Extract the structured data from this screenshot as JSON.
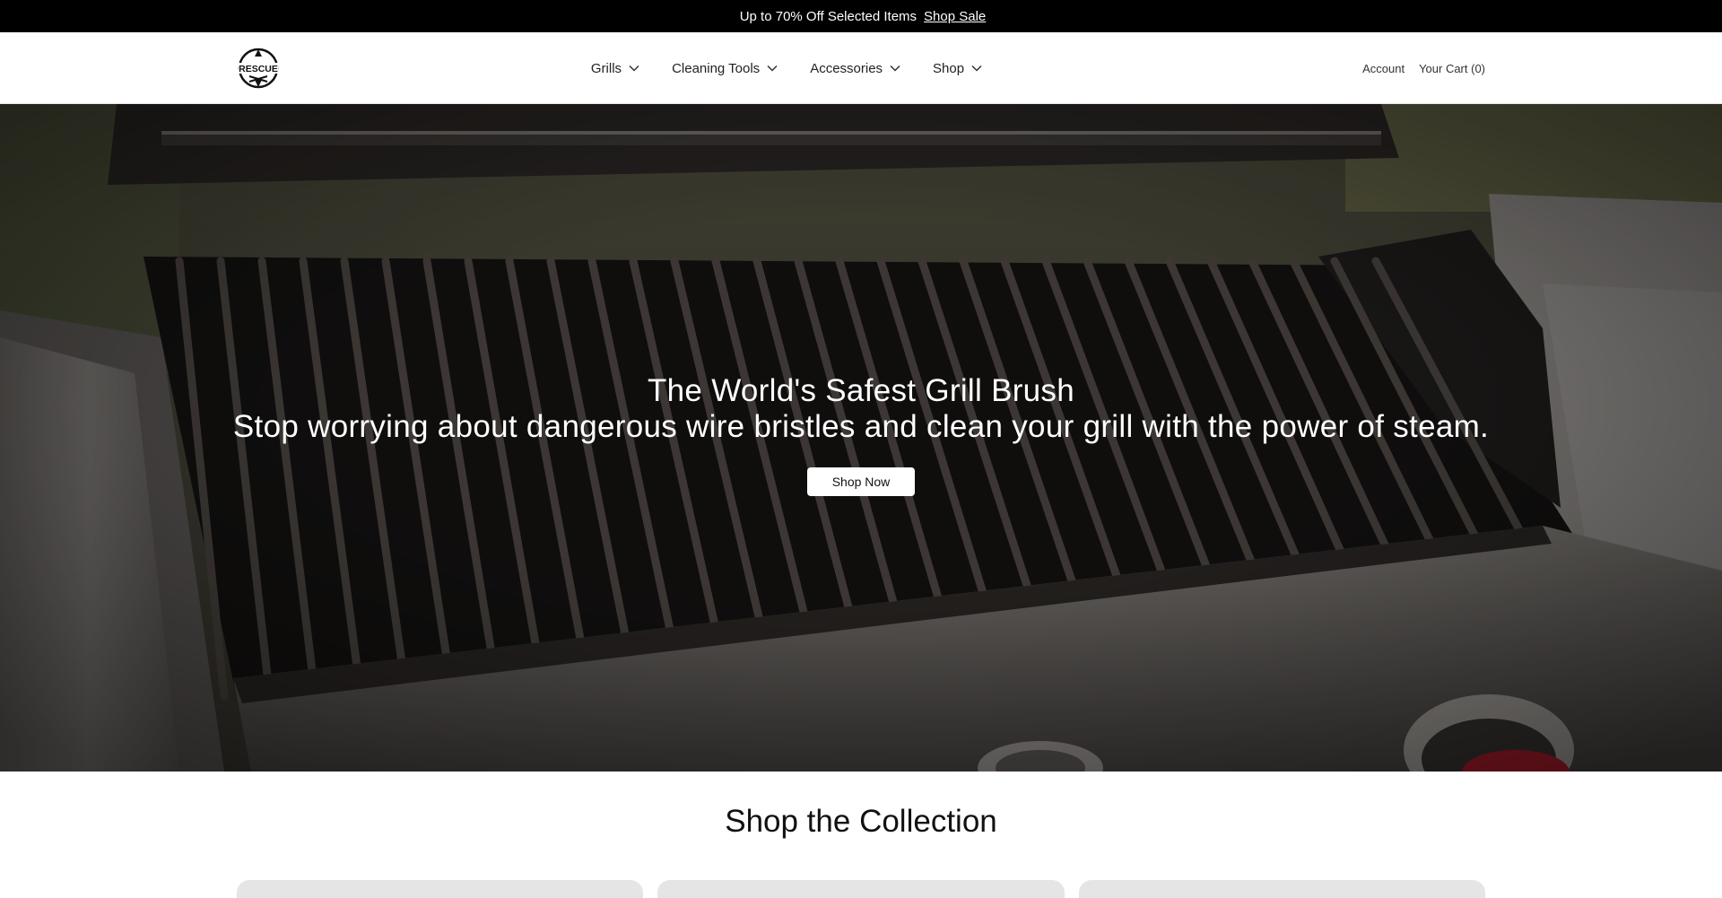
{
  "announcement": {
    "glyph": "",
    "text": "Up to 70% Off Selected Items",
    "link": "Shop Sale",
    "close": ""
  },
  "header": {
    "logo_text": "RESCUE",
    "nav": [
      {
        "label": "Grills"
      },
      {
        "label": "Cleaning Tools"
      },
      {
        "label": "Accessories"
      },
      {
        "label": "Shop"
      }
    ],
    "account": "Account",
    "cart": "Your Cart (0)"
  },
  "hero": {
    "title": "The World's Safest Grill Brush",
    "subtitle": "Stop worrying about dangerous wire bristles and clean your grill with the power of steam.",
    "button": "Shop Now"
  },
  "collection": {
    "title": "Shop the Collection",
    "cards": 3
  },
  "colors": {
    "announcement_bg": "#000000",
    "button_bg": "#ffffff",
    "card_bg": "#e5e5e5"
  }
}
